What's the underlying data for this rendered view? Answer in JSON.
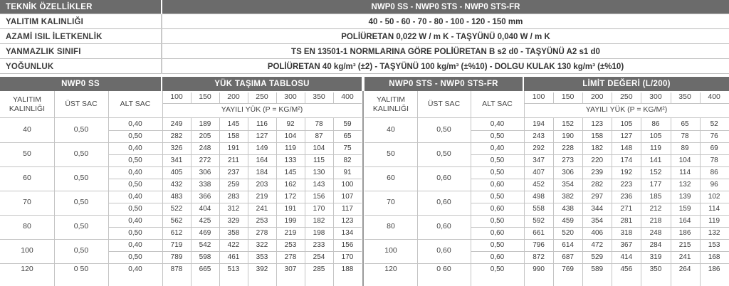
{
  "specs": {
    "header": {
      "label": "TEKNİK ÖZELLİKLER",
      "value": "NWP0 SS - NWP0 STS - NWP0 STS-FR"
    },
    "rows": [
      {
        "label": "YALITIM KALINLIĞI",
        "value": "40   -   50   -   60   -   70   -   80   -   100   -   120 - 150 mm"
      },
      {
        "label": "AZAMİ ISIL İLETKENLİK",
        "value": "POLİÜRETAN          0,022 W / m K   -   TAŞYÜNÜ          0,040 W / m K"
      },
      {
        "label": "YANMAZLIK SINIFI",
        "value": "TS EN 13501-1 NORMLARINA GÖRE  POLİÜRETAN B s2 d0   -   TAŞYÜNÜ A2 s1 d0"
      },
      {
        "label": "YOĞUNLUK",
        "value": "POLİÜRETAN  40 kg/m³ (±2)  -  TAŞYÜNÜ  100 kg/m³ (±%10)  -  DOLGU KULAK 130 kg/m³ (±%10)"
      }
    ]
  },
  "left": {
    "title": "NWP0 SS",
    "load_title": "YÜK TAŞIMA TABLOSU",
    "col_thickness": "YALITIM\nKALINLIĞI",
    "col_top": "ÜST SAC",
    "col_bottom": "ALT SAC",
    "spans": [
      "100",
      "150",
      "200",
      "250",
      "300",
      "350",
      "400"
    ],
    "load_label": "YAYILI YÜK (P = KG/M²)",
    "groups": [
      {
        "thickness": "40",
        "top": "0,50",
        "rows": [
          {
            "bottom": "0,40",
            "v": [
              "249",
              "189",
              "145",
              "116",
              "92",
              "78",
              "59"
            ]
          },
          {
            "bottom": "0,50",
            "v": [
              "282",
              "205",
              "158",
              "127",
              "104",
              "87",
              "65"
            ]
          }
        ]
      },
      {
        "thickness": "50",
        "top": "0,50",
        "rows": [
          {
            "bottom": "0,40",
            "v": [
              "326",
              "248",
              "191",
              "149",
              "119",
              "104",
              "75"
            ]
          },
          {
            "bottom": "0,50",
            "v": [
              "341",
              "272",
              "211",
              "164",
              "133",
              "115",
              "82"
            ]
          }
        ]
      },
      {
        "thickness": "60",
        "top": "0,50",
        "rows": [
          {
            "bottom": "0,40",
            "v": [
              "405",
              "306",
              "237",
              "184",
              "145",
              "130",
              "91"
            ]
          },
          {
            "bottom": "0,50",
            "v": [
              "432",
              "338",
              "259",
              "203",
              "162",
              "143",
              "100"
            ]
          }
        ]
      },
      {
        "thickness": "70",
        "top": "0,50",
        "rows": [
          {
            "bottom": "0,40",
            "v": [
              "483",
              "366",
              "283",
              "219",
              "172",
              "156",
              "107"
            ]
          },
          {
            "bottom": "0,50",
            "v": [
              "522",
              "404",
              "312",
              "241",
              "191",
              "170",
              "117"
            ]
          }
        ]
      },
      {
        "thickness": "80",
        "top": "0,50",
        "rows": [
          {
            "bottom": "0,40",
            "v": [
              "562",
              "425",
              "329",
              "253",
              "199",
              "182",
              "123"
            ]
          },
          {
            "bottom": "0,50",
            "v": [
              "612",
              "469",
              "358",
              "278",
              "219",
              "198",
              "134"
            ]
          }
        ]
      },
      {
        "thickness": "100",
        "top": "0,50",
        "rows": [
          {
            "bottom": "0,40",
            "v": [
              "719",
              "542",
              "422",
              "322",
              "253",
              "233",
              "156"
            ]
          },
          {
            "bottom": "0,50",
            "v": [
              "789",
              "598",
              "461",
              "353",
              "278",
              "254",
              "170"
            ]
          }
        ]
      },
      {
        "thickness": "120",
        "top": "0 50",
        "rows": [
          {
            "bottom": "0,40",
            "v": [
              "878",
              "665",
              "513",
              "392",
              "307",
              "285",
              "188"
            ]
          }
        ]
      }
    ]
  },
  "right": {
    "title": "NWP0 STS - NWP0 STS-FR",
    "limit_title": "LİMİT DEĞERİ (L/200)",
    "col_thickness": "YALITIM\nKALINLIĞI",
    "col_top": "ÜST SAC",
    "col_bottom": "ALT SAC",
    "spans": [
      "100",
      "150",
      "200",
      "250",
      "300",
      "350",
      "400"
    ],
    "load_label": "YAYILI YÜK (P = KG/M²)",
    "groups": [
      {
        "thickness": "40",
        "top": "0,50",
        "rows": [
          {
            "bottom": "0,40",
            "v": [
              "194",
              "152",
              "123",
              "105",
              "86",
              "65",
              "52"
            ]
          },
          {
            "bottom": "0,50",
            "v": [
              "243",
              "190",
              "158",
              "127",
              "105",
              "78",
              "76"
            ]
          }
        ]
      },
      {
        "thickness": "50",
        "top": "0,50",
        "rows": [
          {
            "bottom": "0,40",
            "v": [
              "292",
              "228",
              "182",
              "148",
              "119",
              "89",
              "69"
            ]
          },
          {
            "bottom": "0,50",
            "v": [
              "347",
              "273",
              "220",
              "174",
              "141",
              "104",
              "78"
            ]
          }
        ]
      },
      {
        "thickness": "60",
        "top": "0,60",
        "rows": [
          {
            "bottom": "0,50",
            "v": [
              "407",
              "306",
              "239",
              "192",
              "152",
              "114",
              "86"
            ]
          },
          {
            "bottom": "0,60",
            "v": [
              "452",
              "354",
              "282",
              "223",
              "177",
              "132",
              "96"
            ]
          }
        ]
      },
      {
        "thickness": "70",
        "top": "0,60",
        "rows": [
          {
            "bottom": "0,50",
            "v": [
              "498",
              "382",
              "297",
              "236",
              "185",
              "139",
              "102"
            ]
          },
          {
            "bottom": "0,60",
            "v": [
              "558",
              "438",
              "344",
              "271",
              "212",
              "159",
              "114"
            ]
          }
        ]
      },
      {
        "thickness": "80",
        "top": "0,60",
        "rows": [
          {
            "bottom": "0,50",
            "v": [
              "592",
              "459",
              "354",
              "281",
              "218",
              "164",
              "119"
            ]
          },
          {
            "bottom": "0,60",
            "v": [
              "661",
              "520",
              "406",
              "318",
              "248",
              "186",
              "132"
            ]
          }
        ]
      },
      {
        "thickness": "100",
        "top": "0,60",
        "rows": [
          {
            "bottom": "0,50",
            "v": [
              "796",
              "614",
              "472",
              "367",
              "284",
              "215",
              "153"
            ]
          },
          {
            "bottom": "0,60",
            "v": [
              "872",
              "687",
              "529",
              "414",
              "319",
              "241",
              "168"
            ]
          }
        ]
      },
      {
        "thickness": "120",
        "top": "0 60",
        "rows": [
          {
            "bottom": "0,50",
            "v": [
              "990",
              "769",
              "589",
              "456",
              "350",
              "264",
              "186"
            ]
          }
        ]
      }
    ]
  },
  "colors": {
    "header_bg": "#6b6b6b",
    "grid": "#c4c4c4",
    "text": "#3b3b3b"
  }
}
